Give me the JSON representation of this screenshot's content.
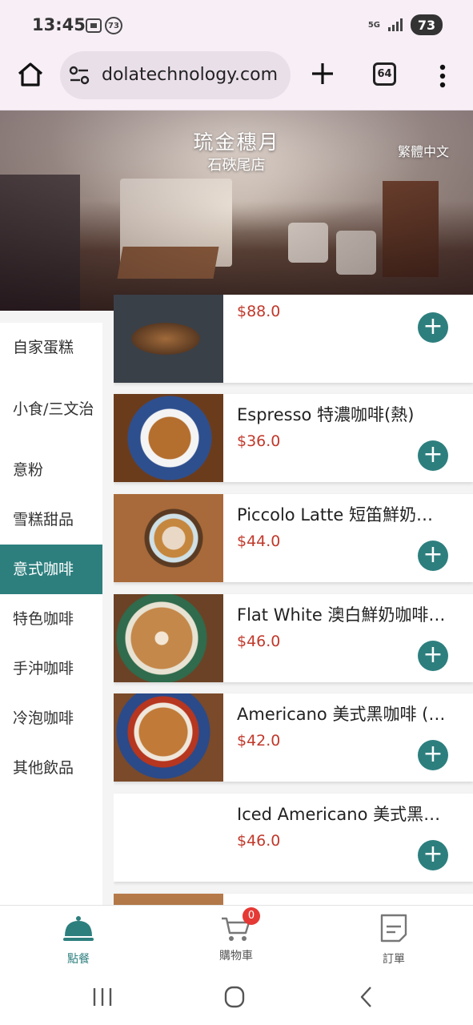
{
  "status_bar": {
    "time": "13:45",
    "notification_count": "73",
    "network": "5G",
    "battery": "73"
  },
  "browser": {
    "url": "dolatechnology.com",
    "tab_count": "64"
  },
  "hero": {
    "title": "琉金穗月",
    "subtitle": "石硤尾店",
    "language": "繁體中文"
  },
  "categories": [
    {
      "label": "自家蛋糕"
    },
    {
      "label": "小食/三文治"
    },
    {
      "label": "意粉"
    },
    {
      "label": "雪糕甜品"
    },
    {
      "label": "意式咖啡"
    },
    {
      "label": "特色咖啡"
    },
    {
      "label": "手沖咖啡"
    },
    {
      "label": "冷泡咖啡"
    },
    {
      "label": "其他飲品"
    }
  ],
  "active_category": "意式咖啡",
  "items": [
    {
      "name": "",
      "price": "$88.0",
      "image": "cake-photo"
    },
    {
      "name": "Espresso 特濃咖啡(熱)",
      "price": "$36.0",
      "image": "espresso-photo"
    },
    {
      "name": "Piccolo Latte 短笛鮮奶…",
      "price": "$44.0",
      "image": "piccolo-photo"
    },
    {
      "name": "Flat White 澳白鮮奶咖啡…",
      "price": "$46.0",
      "image": "flat-white-photo"
    },
    {
      "name": "Americano 美式黑咖啡 (…",
      "price": "$42.0",
      "image": "americano-photo"
    },
    {
      "name": "Iced Americano 美式黑…",
      "price": "$46.0",
      "image": ""
    }
  ],
  "add_label": "+",
  "bottom_nav": {
    "order": "點餐",
    "cart": "購物車",
    "cart_count": "0",
    "orders": "訂單"
  },
  "colors": {
    "accent": "#2d7f7e",
    "price": "#c0392b",
    "badge": "#e53935"
  }
}
